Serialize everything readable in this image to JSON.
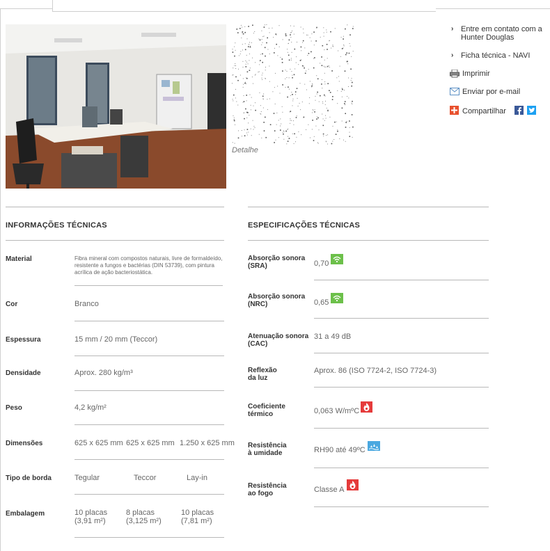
{
  "sidebar": {
    "links": [
      {
        "label": "Entre em contato com a Hunter Douglas",
        "icon": "chevron-right-icon"
      },
      {
        "label": "Ficha técnica - NAVI",
        "icon": "chevron-right-icon"
      },
      {
        "label": "Imprimir",
        "icon": "printer-icon"
      },
      {
        "label": "Enviar por e-mail",
        "icon": "envelope-icon"
      },
      {
        "label": "Compartilhar",
        "icon": "plus-share-icon"
      }
    ],
    "social": [
      "facebook-icon",
      "twitter-icon"
    ]
  },
  "media": {
    "detail_caption": "Detalhe"
  },
  "tech_info": {
    "title": "INFORMAÇÕES TÉCNICAS",
    "rows": [
      {
        "label": "Material",
        "value": "Fibra mineral com compostos naturais, livre de formaldeído, resistente a fungos e bactérias (DIN 53739), com pintura acrílica de ação bacteriostática."
      },
      {
        "label": "Cor",
        "value": "Branco"
      },
      {
        "label": "Espessura",
        "value": "15 mm / 20 mm (Teccor)"
      },
      {
        "label": "Densidade",
        "value": "Aprox. 280 kg/m³"
      },
      {
        "label": "Peso",
        "value": "4,2 kg/m²"
      },
      {
        "label": "Dimensões",
        "values": [
          "625 x 625 mm",
          "625 x 625 mm",
          "1.250 x 625 mm"
        ]
      },
      {
        "label": "Tipo de borda",
        "values": [
          "Tegular",
          "Teccor",
          "Lay-in"
        ]
      },
      {
        "label": "Embalagem",
        "values": [
          "10 placas\n(3,91 m²)",
          "8 placas\n(3,125 m²)",
          "10 placas\n(7,81 m²)"
        ]
      }
    ]
  },
  "tech_specs": {
    "title": "ESPECIFICAÇÕES TÉCNICAS",
    "rows": [
      {
        "label": "Absorção sonora\n(SRA)",
        "value": "0,70",
        "badge": "sound-wave-icon",
        "badge_color": "#6cc04a"
      },
      {
        "label": "Absorção sonora\n(NRC)",
        "value": "0,65",
        "badge": "sound-wave-icon",
        "badge_color": "#6cc04a"
      },
      {
        "label": "Atenuação sonora\n(CAC)",
        "value": "31 a 49 dB"
      },
      {
        "label": "Reflexão\nda luz",
        "value": "Aprox. 86 (ISO 7724-2, ISO 7724-3)"
      },
      {
        "label": "Coeficiente\ntérmico",
        "value": "0,063 W/mºC",
        "badge": "flame-icon",
        "badge_color": "#e53b3b"
      },
      {
        "label": "Resistência\nà umidade",
        "value": "RH90 até 49ºC",
        "badge": "humidity-icon",
        "badge_color": "#4aa8e0"
      },
      {
        "label": "Resistência\nao fogo",
        "value": "Classe A",
        "badge": "flame-icon",
        "badge_color": "#e53b3b"
      }
    ]
  }
}
